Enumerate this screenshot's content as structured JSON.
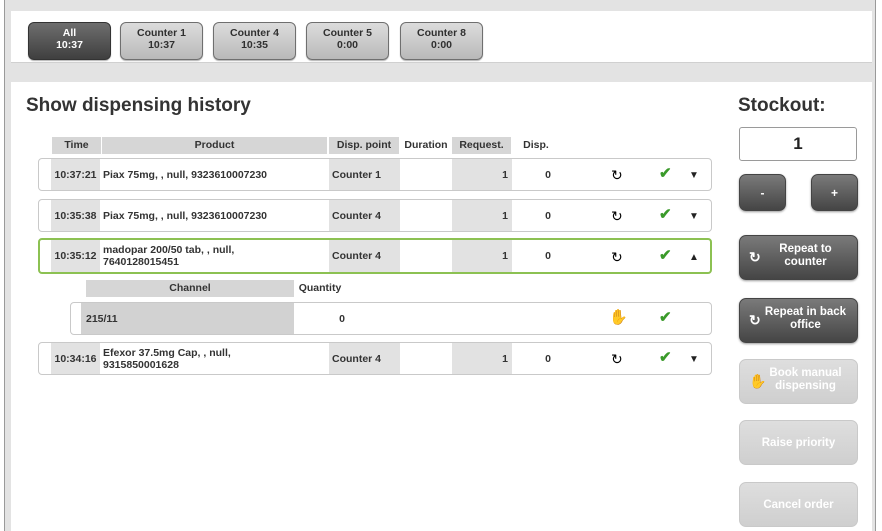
{
  "counter_tabs": [
    {
      "name": "All",
      "time": "10:37",
      "active": true
    },
    {
      "name": "Counter 1",
      "time": "10:37",
      "active": false
    },
    {
      "name": "Counter 4",
      "time": "10:35",
      "active": false
    },
    {
      "name": "Counter 5",
      "time": "0:00",
      "active": false
    },
    {
      "name": "Counter 8",
      "time": "0:00",
      "active": false
    }
  ],
  "page_title": "Show dispensing history",
  "table_headers": {
    "time": "Time",
    "product": "Product",
    "disp_point": "Disp. point",
    "duration": "Duration",
    "request": "Request.",
    "disp": "Disp."
  },
  "rows": [
    {
      "time": "10:37:21",
      "product": "Piax 75mg, , null, 9323610007230",
      "disp_point": "Counter 1",
      "duration": "",
      "request": "1",
      "disp": "0",
      "expand": "down"
    },
    {
      "time": "10:35:38",
      "product": "Piax 75mg, , null, 9323610007230",
      "disp_point": "Counter 4",
      "duration": "",
      "request": "1",
      "disp": "0",
      "expand": "down"
    },
    {
      "time": "10:35:12",
      "product": "madopar 200/50 tab, , null, 7640128015451",
      "disp_point": "Counter 4",
      "duration": "",
      "request": "1",
      "disp": "0",
      "expand": "up"
    },
    {
      "time": "10:34:16",
      "product": "Efexor 37.5mg Cap, , null, 9315850001628",
      "disp_point": "Counter 4",
      "duration": "",
      "request": "1",
      "disp": "0",
      "expand": "down"
    }
  ],
  "sub_table": {
    "headers": {
      "channel": "Channel",
      "quantity": "Quantity"
    },
    "rows": [
      {
        "channel": "215/11",
        "quantity": "0"
      }
    ]
  },
  "sidebar": {
    "stockout_label": "Stockout:",
    "stockout_value": "1",
    "minus_label": "-",
    "plus_label": "+",
    "repeat_counter_label": "Repeat to counter",
    "repeat_back_office_label": "Repeat in back office",
    "book_manual_label": "Book manual dispensing",
    "raise_priority_label": "Raise priority",
    "cancel_order_label": "Cancel order"
  },
  "colors": {
    "selected_border": "#8cc152",
    "check_green": "#3a9a2a",
    "active_tab": "#4a4a4a",
    "dark_button": "#5a5a5a",
    "disabled_button": "#d6d6d6"
  },
  "icons": {
    "refresh": "refresh-icon",
    "check": "check-icon",
    "arrow_down": "arrow-down-icon",
    "arrow_up": "arrow-up-icon",
    "hand": "hand-icon"
  }
}
